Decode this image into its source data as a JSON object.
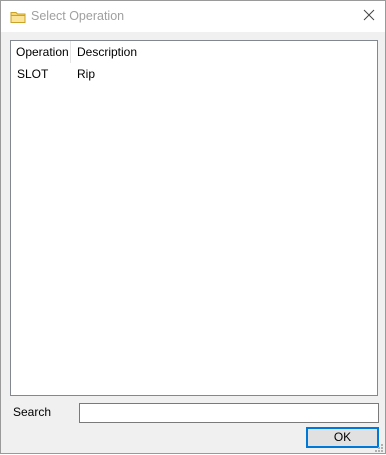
{
  "window": {
    "title": "Select Operation",
    "icon": "folder-icon",
    "close_icon": "close-icon"
  },
  "list": {
    "columns": [
      {
        "label": "Operation"
      },
      {
        "label": "Description"
      }
    ],
    "rows": [
      {
        "operation": "SLOT",
        "description": "Rip"
      }
    ]
  },
  "search": {
    "label": "Search",
    "value": ""
  },
  "buttons": {
    "ok_label": "OK"
  },
  "colors": {
    "accent": "#0078d7",
    "title_text": "#a0a0a0",
    "folder_yellow": "#f7d774"
  }
}
